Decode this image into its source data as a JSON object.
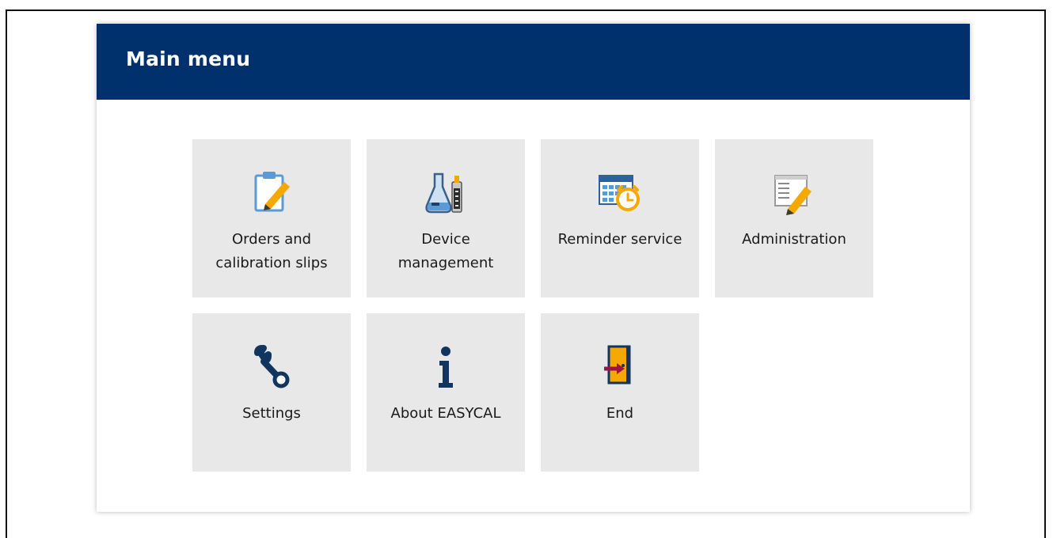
{
  "window": {
    "title": "Main menu"
  },
  "tiles": [
    {
      "label": "Orders and\ncalibration slips",
      "icon": "clipboard-pencil-icon"
    },
    {
      "label": "Device\nmanagement",
      "icon": "flask-device-icon"
    },
    {
      "label": "Reminder service",
      "icon": "calendar-alarm-clock-icon"
    },
    {
      "label": "Administration",
      "icon": "list-pencil-icon"
    },
    {
      "label": "Settings",
      "icon": "wrench-icon"
    },
    {
      "label": "About EASYCAL",
      "icon": "info-icon"
    },
    {
      "label": "End",
      "icon": "exit-door-icon"
    }
  ],
  "colors": {
    "header": "#00316c",
    "tile": "#e8e8e8",
    "accent_orange": "#f5a800",
    "exit_arrow": "#a0114a"
  }
}
